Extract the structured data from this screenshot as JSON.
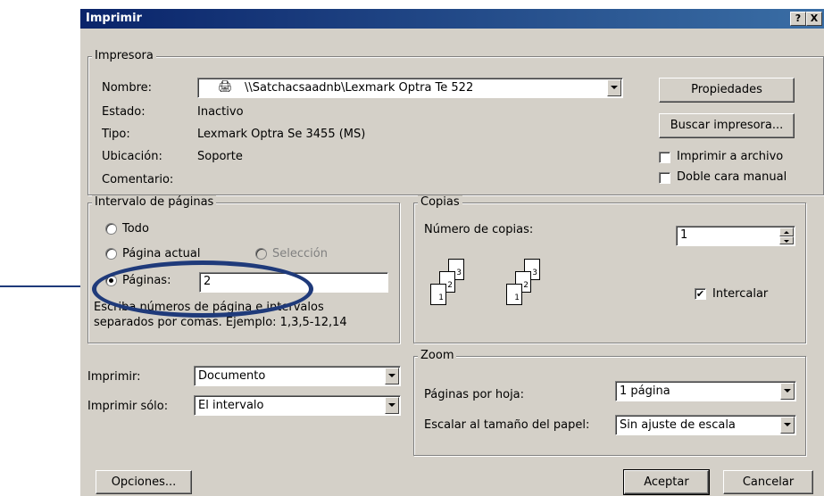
{
  "title": "Imprimir",
  "titlebar": {
    "help": "?",
    "close": "X"
  },
  "printer": {
    "legend": "Impresora",
    "name_label": "Nombre:",
    "name_value": "\\\\Satchacsaadnb\\Lexmark Optra Te 522",
    "status_label": "Estado:",
    "status_value": "Inactivo",
    "type_label": "Tipo:",
    "type_value": "Lexmark Optra Se 3455 (MS)",
    "location_label": "Ubicación:",
    "location_value": "Soporte",
    "comment_label": "Comentario:",
    "properties_button": "Propiedades",
    "find_printer_button": "Buscar impresora...",
    "print_to_file_label": "Imprimir a archivo",
    "manual_duplex_label": "Doble cara manual"
  },
  "range": {
    "legend": "Intervalo de páginas",
    "all_label": "Todo",
    "current_page_label": "Página actual",
    "selection_label": "Selección",
    "pages_label": "Páginas:",
    "pages_value": "2",
    "hint_line1": "Escriba números de página e intervalos",
    "hint_line2": "separados por comas. Ejemplo: 1,3,5-12,14"
  },
  "copies": {
    "legend": "Copias",
    "count_label": "Número de copias:",
    "count_value": "1",
    "collate_label": "Intercalar",
    "collate_checked": true
  },
  "print_what": {
    "label": "Imprimir:",
    "value": "Documento"
  },
  "print_only": {
    "label": "Imprimir sólo:",
    "value": "El intervalo"
  },
  "zoom": {
    "legend": "Zoom",
    "pages_per_sheet_label": "Páginas por hoja:",
    "pages_per_sheet_value": "1 página",
    "scale_label": "Escalar al tamaño del papel:",
    "scale_value": "Sin ajuste de escala"
  },
  "footer": {
    "options_button": "Opciones...",
    "ok_button": "Aceptar",
    "cancel_button": "Cancelar"
  },
  "colors": {
    "titlebar": "#0a246a",
    "annotation": "#1f3a7a",
    "face": "#d4d0c8"
  }
}
